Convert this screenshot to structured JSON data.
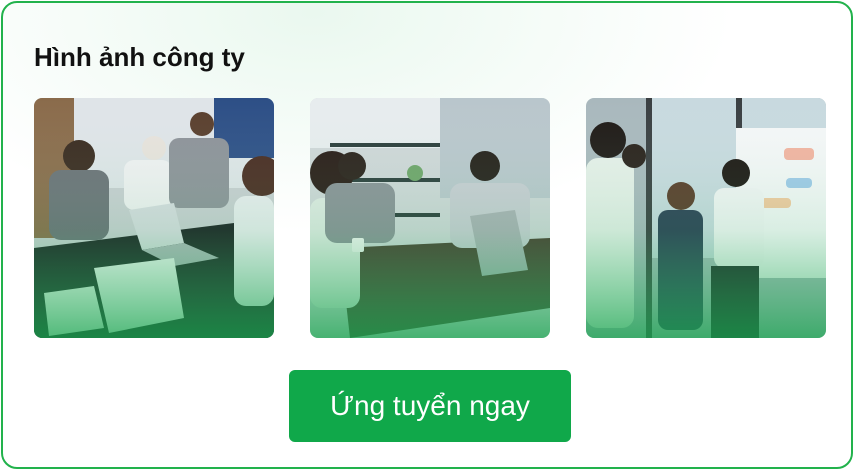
{
  "section": {
    "title": "Hình ảnh công ty"
  },
  "gallery": {
    "photos": [
      {
        "subject": "team meeting around conference table with laptop"
      },
      {
        "subject": "colleagues seated at meeting table with laptop"
      },
      {
        "subject": "team standing by whiteboard in office"
      }
    ]
  },
  "cta": {
    "label": "Ứng tuyển ngay"
  },
  "colors": {
    "brand_green": "#10a84a",
    "border_green": "#22b24c",
    "title_text": "#111111"
  }
}
